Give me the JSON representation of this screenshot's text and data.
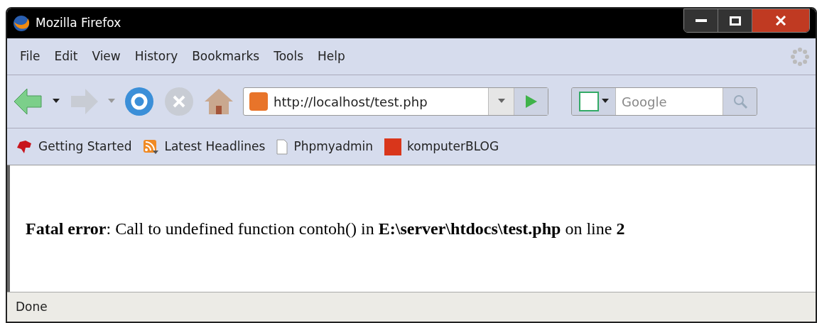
{
  "window": {
    "title": "Mozilla Firefox"
  },
  "menu": [
    "File",
    "Edit",
    "View",
    "History",
    "Bookmarks",
    "Tools",
    "Help"
  ],
  "address_bar": {
    "value": "http://localhost/test.php"
  },
  "search": {
    "placeholder": "Google"
  },
  "bookmarks": [
    {
      "label": "Getting Started",
      "kind": "dino"
    },
    {
      "label": "Latest Headlines",
      "kind": "feed"
    },
    {
      "label": "Phpmyadmin",
      "kind": "page"
    },
    {
      "label": "komputerBLOG",
      "kind": "k"
    }
  ],
  "content": {
    "message": "**Fatal error**: Call to undefined function contoh() in **E:\\server\\htdocs\\test.php** on line **2**"
  },
  "status_bar": {
    "text": "Done"
  }
}
